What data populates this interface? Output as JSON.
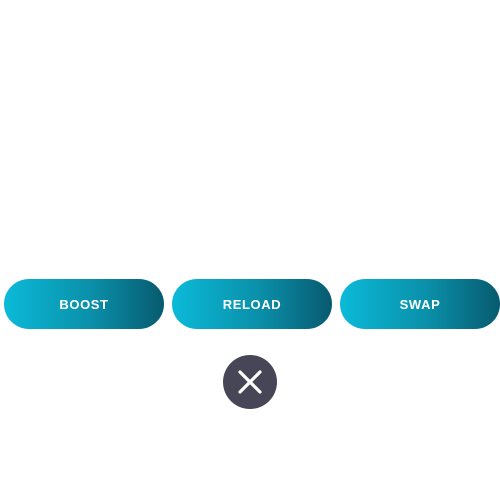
{
  "actions": {
    "boost_label": "BOOST",
    "reload_label": "RELOAD",
    "swap_label": "SWAP"
  },
  "close": {
    "icon": "close-icon"
  },
  "colors": {
    "button_gradient_start": "#0bbad8",
    "button_gradient_end": "#075a6e",
    "button_text": "#ffffff",
    "close_background": "#474657",
    "close_icon": "#ffffff",
    "page_background": "#ffffff"
  }
}
